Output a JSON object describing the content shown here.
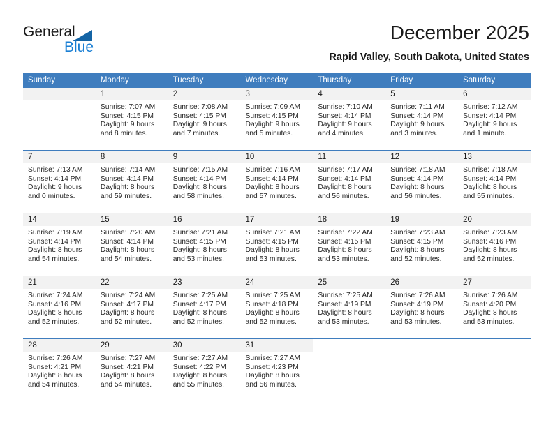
{
  "logo": {
    "line1": "General",
    "line2": "Blue",
    "triangle_color": "#1464a5",
    "blue_text_color": "#1a7fd4"
  },
  "header": {
    "title": "December 2025",
    "subtitle": "Rapid Valley, South Dakota, United States"
  },
  "theme": {
    "header_bg": "#3f7dbe",
    "daynum_bg": "#f2f2f2",
    "text": "#262626"
  },
  "weekday_headers": [
    "Sunday",
    "Monday",
    "Tuesday",
    "Wednesday",
    "Thursday",
    "Friday",
    "Saturday"
  ],
  "weeks": [
    [
      {
        "day": "",
        "sunrise": "",
        "sunset": "",
        "daylight1": "",
        "daylight2": "",
        "state": "empty"
      },
      {
        "day": "1",
        "sunrise": "Sunrise: 7:07 AM",
        "sunset": "Sunset: 4:15 PM",
        "daylight1": "Daylight: 9 hours",
        "daylight2": "and 8 minutes.",
        "state": "filled"
      },
      {
        "day": "2",
        "sunrise": "Sunrise: 7:08 AM",
        "sunset": "Sunset: 4:15 PM",
        "daylight1": "Daylight: 9 hours",
        "daylight2": "and 7 minutes.",
        "state": "filled"
      },
      {
        "day": "3",
        "sunrise": "Sunrise: 7:09 AM",
        "sunset": "Sunset: 4:15 PM",
        "daylight1": "Daylight: 9 hours",
        "daylight2": "and 5 minutes.",
        "state": "filled"
      },
      {
        "day": "4",
        "sunrise": "Sunrise: 7:10 AM",
        "sunset": "Sunset: 4:14 PM",
        "daylight1": "Daylight: 9 hours",
        "daylight2": "and 4 minutes.",
        "state": "filled"
      },
      {
        "day": "5",
        "sunrise": "Sunrise: 7:11 AM",
        "sunset": "Sunset: 4:14 PM",
        "daylight1": "Daylight: 9 hours",
        "daylight2": "and 3 minutes.",
        "state": "filled"
      },
      {
        "day": "6",
        "sunrise": "Sunrise: 7:12 AM",
        "sunset": "Sunset: 4:14 PM",
        "daylight1": "Daylight: 9 hours",
        "daylight2": "and 1 minute.",
        "state": "filled"
      }
    ],
    [
      {
        "day": "7",
        "sunrise": "Sunrise: 7:13 AM",
        "sunset": "Sunset: 4:14 PM",
        "daylight1": "Daylight: 9 hours",
        "daylight2": "and 0 minutes.",
        "state": "filled"
      },
      {
        "day": "8",
        "sunrise": "Sunrise: 7:14 AM",
        "sunset": "Sunset: 4:14 PM",
        "daylight1": "Daylight: 8 hours",
        "daylight2": "and 59 minutes.",
        "state": "filled"
      },
      {
        "day": "9",
        "sunrise": "Sunrise: 7:15 AM",
        "sunset": "Sunset: 4:14 PM",
        "daylight1": "Daylight: 8 hours",
        "daylight2": "and 58 minutes.",
        "state": "filled"
      },
      {
        "day": "10",
        "sunrise": "Sunrise: 7:16 AM",
        "sunset": "Sunset: 4:14 PM",
        "daylight1": "Daylight: 8 hours",
        "daylight2": "and 57 minutes.",
        "state": "filled"
      },
      {
        "day": "11",
        "sunrise": "Sunrise: 7:17 AM",
        "sunset": "Sunset: 4:14 PM",
        "daylight1": "Daylight: 8 hours",
        "daylight2": "and 56 minutes.",
        "state": "filled"
      },
      {
        "day": "12",
        "sunrise": "Sunrise: 7:18 AM",
        "sunset": "Sunset: 4:14 PM",
        "daylight1": "Daylight: 8 hours",
        "daylight2": "and 56 minutes.",
        "state": "filled"
      },
      {
        "day": "13",
        "sunrise": "Sunrise: 7:18 AM",
        "sunset": "Sunset: 4:14 PM",
        "daylight1": "Daylight: 8 hours",
        "daylight2": "and 55 minutes.",
        "state": "filled"
      }
    ],
    [
      {
        "day": "14",
        "sunrise": "Sunrise: 7:19 AM",
        "sunset": "Sunset: 4:14 PM",
        "daylight1": "Daylight: 8 hours",
        "daylight2": "and 54 minutes.",
        "state": "filled"
      },
      {
        "day": "15",
        "sunrise": "Sunrise: 7:20 AM",
        "sunset": "Sunset: 4:14 PM",
        "daylight1": "Daylight: 8 hours",
        "daylight2": "and 54 minutes.",
        "state": "filled"
      },
      {
        "day": "16",
        "sunrise": "Sunrise: 7:21 AM",
        "sunset": "Sunset: 4:15 PM",
        "daylight1": "Daylight: 8 hours",
        "daylight2": "and 53 minutes.",
        "state": "filled"
      },
      {
        "day": "17",
        "sunrise": "Sunrise: 7:21 AM",
        "sunset": "Sunset: 4:15 PM",
        "daylight1": "Daylight: 8 hours",
        "daylight2": "and 53 minutes.",
        "state": "filled"
      },
      {
        "day": "18",
        "sunrise": "Sunrise: 7:22 AM",
        "sunset": "Sunset: 4:15 PM",
        "daylight1": "Daylight: 8 hours",
        "daylight2": "and 53 minutes.",
        "state": "filled"
      },
      {
        "day": "19",
        "sunrise": "Sunrise: 7:23 AM",
        "sunset": "Sunset: 4:15 PM",
        "daylight1": "Daylight: 8 hours",
        "daylight2": "and 52 minutes.",
        "state": "filled"
      },
      {
        "day": "20",
        "sunrise": "Sunrise: 7:23 AM",
        "sunset": "Sunset: 4:16 PM",
        "daylight1": "Daylight: 8 hours",
        "daylight2": "and 52 minutes.",
        "state": "filled"
      }
    ],
    [
      {
        "day": "21",
        "sunrise": "Sunrise: 7:24 AM",
        "sunset": "Sunset: 4:16 PM",
        "daylight1": "Daylight: 8 hours",
        "daylight2": "and 52 minutes.",
        "state": "filled"
      },
      {
        "day": "22",
        "sunrise": "Sunrise: 7:24 AM",
        "sunset": "Sunset: 4:17 PM",
        "daylight1": "Daylight: 8 hours",
        "daylight2": "and 52 minutes.",
        "state": "filled"
      },
      {
        "day": "23",
        "sunrise": "Sunrise: 7:25 AM",
        "sunset": "Sunset: 4:17 PM",
        "daylight1": "Daylight: 8 hours",
        "daylight2": "and 52 minutes.",
        "state": "filled"
      },
      {
        "day": "24",
        "sunrise": "Sunrise: 7:25 AM",
        "sunset": "Sunset: 4:18 PM",
        "daylight1": "Daylight: 8 hours",
        "daylight2": "and 52 minutes.",
        "state": "filled"
      },
      {
        "day": "25",
        "sunrise": "Sunrise: 7:25 AM",
        "sunset": "Sunset: 4:19 PM",
        "daylight1": "Daylight: 8 hours",
        "daylight2": "and 53 minutes.",
        "state": "filled"
      },
      {
        "day": "26",
        "sunrise": "Sunrise: 7:26 AM",
        "sunset": "Sunset: 4:19 PM",
        "daylight1": "Daylight: 8 hours",
        "daylight2": "and 53 minutes.",
        "state": "filled"
      },
      {
        "day": "27",
        "sunrise": "Sunrise: 7:26 AM",
        "sunset": "Sunset: 4:20 PM",
        "daylight1": "Daylight: 8 hours",
        "daylight2": "and 53 minutes.",
        "state": "filled"
      }
    ],
    [
      {
        "day": "28",
        "sunrise": "Sunrise: 7:26 AM",
        "sunset": "Sunset: 4:21 PM",
        "daylight1": "Daylight: 8 hours",
        "daylight2": "and 54 minutes.",
        "state": "filled"
      },
      {
        "day": "29",
        "sunrise": "Sunrise: 7:27 AM",
        "sunset": "Sunset: 4:21 PM",
        "daylight1": "Daylight: 8 hours",
        "daylight2": "and 54 minutes.",
        "state": "filled"
      },
      {
        "day": "30",
        "sunrise": "Sunrise: 7:27 AM",
        "sunset": "Sunset: 4:22 PM",
        "daylight1": "Daylight: 8 hours",
        "daylight2": "and 55 minutes.",
        "state": "filled"
      },
      {
        "day": "31",
        "sunrise": "Sunrise: 7:27 AM",
        "sunset": "Sunset: 4:23 PM",
        "daylight1": "Daylight: 8 hours",
        "daylight2": "and 56 minutes.",
        "state": "filled"
      },
      {
        "day": "",
        "sunrise": "",
        "sunset": "",
        "daylight1": "",
        "daylight2": "",
        "state": "blank"
      },
      {
        "day": "",
        "sunrise": "",
        "sunset": "",
        "daylight1": "",
        "daylight2": "",
        "state": "blank"
      },
      {
        "day": "",
        "sunrise": "",
        "sunset": "",
        "daylight1": "",
        "daylight2": "",
        "state": "blank"
      }
    ]
  ]
}
